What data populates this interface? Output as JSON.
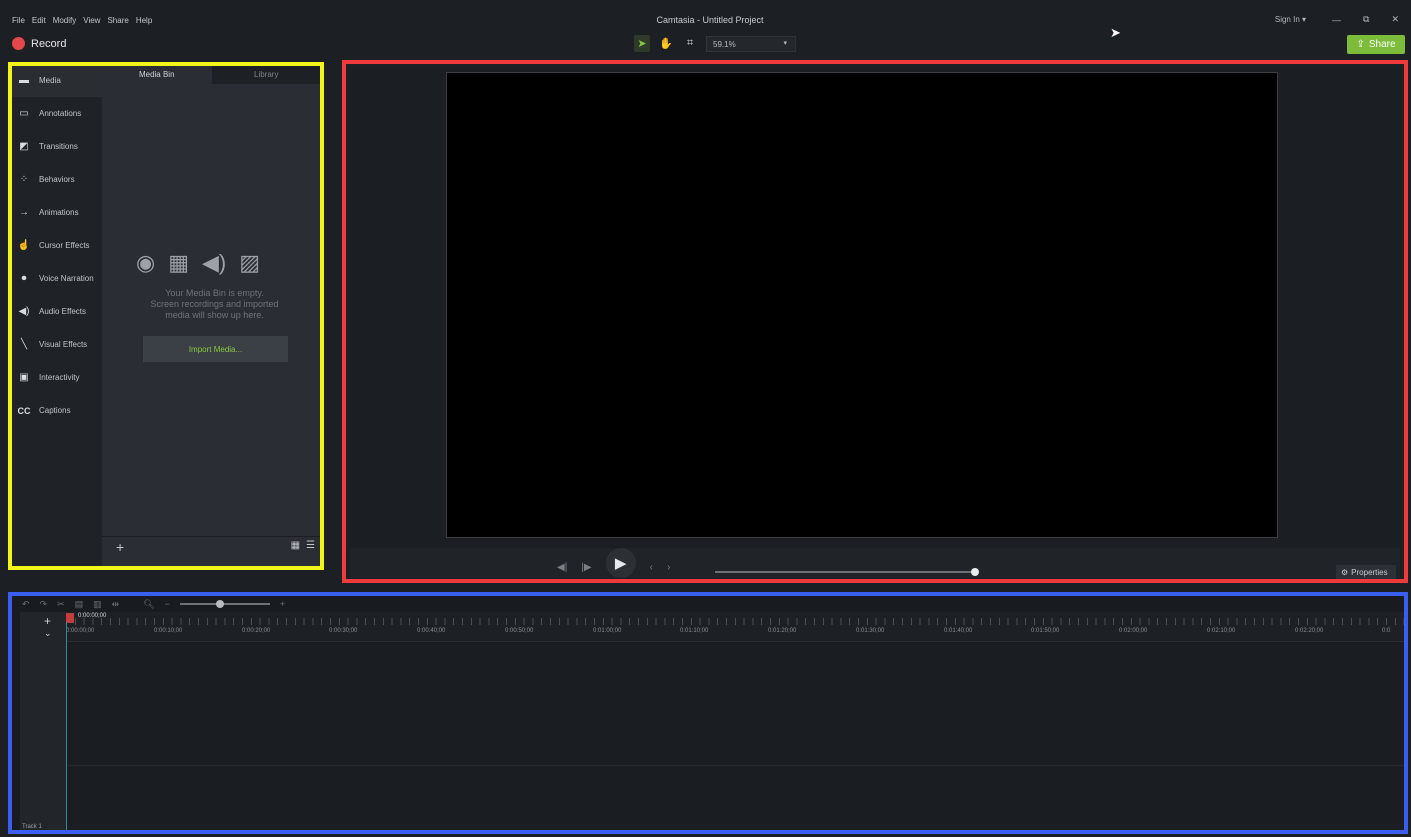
{
  "app": {
    "title": "Camtasia - Untitled Project",
    "menu": [
      "File",
      "Edit",
      "Modify",
      "View",
      "Share",
      "Help"
    ],
    "sign_in": "Sign In ▾",
    "window_controls": [
      "—",
      "⧉",
      "✕"
    ]
  },
  "toolbar": {
    "record_label": "Record",
    "zoom": "59.1%",
    "share_label": "Share"
  },
  "left_nav": {
    "items": [
      {
        "label": "Media",
        "icon": "media-icon"
      },
      {
        "label": "Annotations",
        "icon": "annotations-icon"
      },
      {
        "label": "Transitions",
        "icon": "transitions-icon"
      },
      {
        "label": "Behaviors",
        "icon": "behaviors-icon"
      },
      {
        "label": "Animations",
        "icon": "animations-icon"
      },
      {
        "label": "Cursor Effects",
        "icon": "cursor-effects-icon"
      },
      {
        "label": "Voice Narration",
        "icon": "microphone-icon"
      },
      {
        "label": "Audio Effects",
        "icon": "speaker-icon"
      },
      {
        "label": "Visual Effects",
        "icon": "magic-wand-icon"
      },
      {
        "label": "Interactivity",
        "icon": "interactivity-icon"
      },
      {
        "label": "Captions",
        "icon": "cc-icon"
      }
    ]
  },
  "media_bin": {
    "tabs": [
      "Media Bin",
      "Library"
    ],
    "empty_line1": "Your Media Bin is empty.",
    "empty_line2": "Screen recordings and imported",
    "empty_line3": "media will show up here.",
    "import_label": "Import Media...",
    "add_label": "+"
  },
  "playback": {
    "properties_label": "Properties"
  },
  "timeline": {
    "playhead_time": "0:00:00;00",
    "ticks": [
      "0:00:00;00",
      "0:00:10;00",
      "0:00:20;00",
      "0:00:30;00",
      "0:00:40;00",
      "0:00:50;00",
      "0:01:00;00",
      "0:01:10;00",
      "0:01:20;00",
      "0:01:30;00",
      "0:01:40;00",
      "0:01:50;00",
      "0:02:00;00",
      "0:02:10;00",
      "0:02:20;00",
      "0:0"
    ],
    "track_label": "Track 1"
  }
}
